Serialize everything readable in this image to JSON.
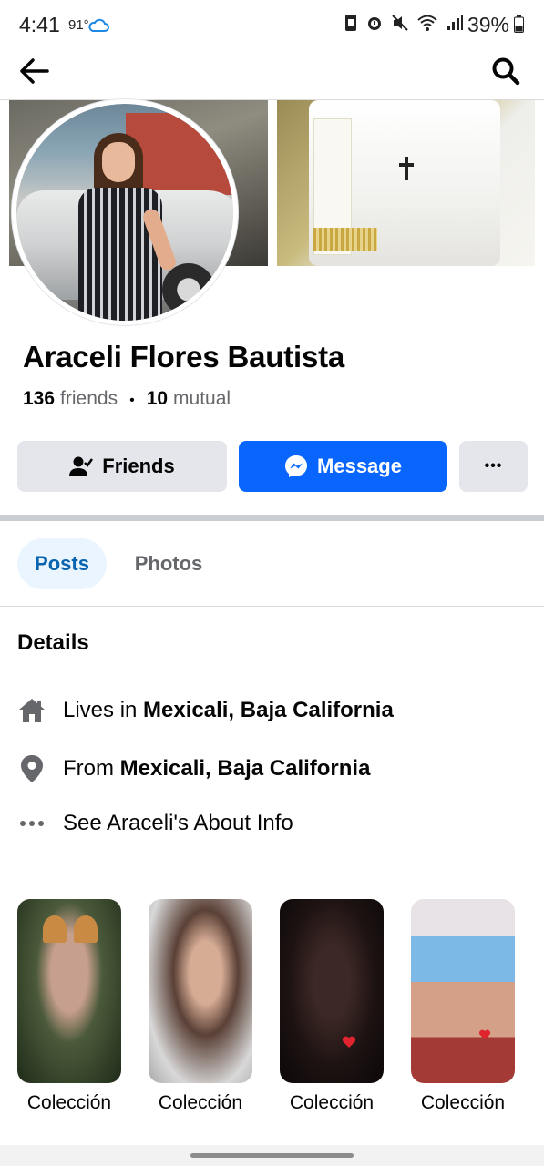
{
  "status_bar": {
    "time": "4:41",
    "temperature": "91°",
    "battery": "39%"
  },
  "nav": {
    "back_icon": "arrow-left-icon",
    "search_icon": "search-icon"
  },
  "profile": {
    "name": "Araceli Flores Bautista",
    "friends_count": "136",
    "friends_label": "friends",
    "mutual_count": "10",
    "mutual_label": "mutual"
  },
  "actions": {
    "friends_label": "Friends",
    "message_label": "Message",
    "more_label": "•••"
  },
  "tabs": [
    {
      "label": "Posts",
      "active": true
    },
    {
      "label": "Photos",
      "active": false
    }
  ],
  "details": {
    "title": "Details",
    "lives_prefix": "Lives in ",
    "lives_place": "Mexicali, Baja California",
    "from_prefix": "From ",
    "from_place": "Mexicali, Baja California",
    "about_link": "See Araceli's About Info"
  },
  "collections": [
    {
      "label": "Colección"
    },
    {
      "label": "Colección"
    },
    {
      "label": "Colección"
    },
    {
      "label": "Colección"
    }
  ],
  "colors": {
    "accent": "#0866ff",
    "tab_active_bg": "#ebf5ff",
    "tab_active_text": "#0864b1",
    "button_gray": "#e4e6eb"
  }
}
